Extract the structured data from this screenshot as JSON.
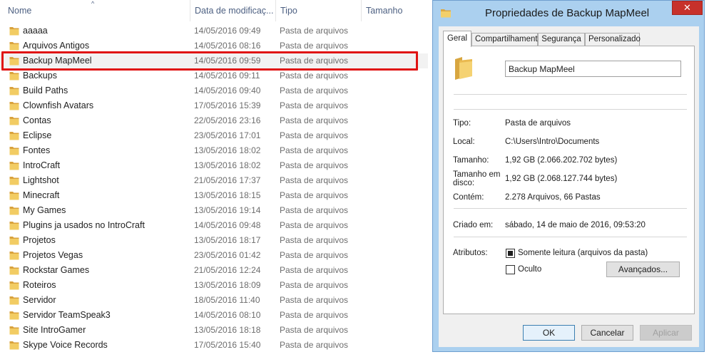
{
  "explorer": {
    "columns": {
      "name": "Nome",
      "date": "Data de modificaç...",
      "type": "Tipo",
      "size": "Tamanho"
    },
    "sort_indicator": "^",
    "rows": [
      {
        "name": "aaaaa",
        "date": "14/05/2016 09:49",
        "type": "Pasta de arquivos"
      },
      {
        "name": "Arquivos Antigos",
        "date": "14/05/2016 08:16",
        "type": "Pasta de arquivos"
      },
      {
        "name": "Backup MapMeel",
        "date": "14/05/2016 09:59",
        "type": "Pasta de arquivos"
      },
      {
        "name": "Backups",
        "date": "14/05/2016 09:11",
        "type": "Pasta de arquivos"
      },
      {
        "name": "Build Paths",
        "date": "14/05/2016 09:40",
        "type": "Pasta de arquivos"
      },
      {
        "name": "Clownfish Avatars",
        "date": "17/05/2016 15:39",
        "type": "Pasta de arquivos"
      },
      {
        "name": "Contas",
        "date": "22/05/2016 23:16",
        "type": "Pasta de arquivos"
      },
      {
        "name": "Eclipse",
        "date": "23/05/2016 17:01",
        "type": "Pasta de arquivos"
      },
      {
        "name": "Fontes",
        "date": "13/05/2016 18:02",
        "type": "Pasta de arquivos"
      },
      {
        "name": "IntroCraft",
        "date": "13/05/2016 18:02",
        "type": "Pasta de arquivos"
      },
      {
        "name": "Lightshot",
        "date": "21/05/2016 17:37",
        "type": "Pasta de arquivos"
      },
      {
        "name": "Minecraft",
        "date": "13/05/2016 18:15",
        "type": "Pasta de arquivos"
      },
      {
        "name": "My Games",
        "date": "13/05/2016 19:14",
        "type": "Pasta de arquivos"
      },
      {
        "name": "Plugins ja usados no IntroCraft",
        "date": "14/05/2016 09:48",
        "type": "Pasta de arquivos"
      },
      {
        "name": "Projetos",
        "date": "13/05/2016 18:17",
        "type": "Pasta de arquivos"
      },
      {
        "name": "Projetos Vegas",
        "date": "23/05/2016 01:42",
        "type": "Pasta de arquivos"
      },
      {
        "name": "Rockstar Games",
        "date": "21/05/2016 12:24",
        "type": "Pasta de arquivos"
      },
      {
        "name": "Roteiros",
        "date": "13/05/2016 18:09",
        "type": "Pasta de arquivos"
      },
      {
        "name": "Servidor",
        "date": "18/05/2016 11:40",
        "type": "Pasta de arquivos"
      },
      {
        "name": "Servidor TeamSpeak3",
        "date": "14/05/2016 08:10",
        "type": "Pasta de arquivos"
      },
      {
        "name": "Site IntroGamer",
        "date": "13/05/2016 18:18",
        "type": "Pasta de arquivos"
      },
      {
        "name": "Skype Voice Records",
        "date": "17/05/2016 15:40",
        "type": "Pasta de arquivos"
      }
    ],
    "selected_row": 2
  },
  "dialog": {
    "title": "Propriedades de Backup MapMeel",
    "close_glyph": "✕",
    "tabs": [
      {
        "label": "Geral",
        "active": true
      },
      {
        "label": "Compartilhamento",
        "active": false
      },
      {
        "label": "Segurança",
        "active": false
      },
      {
        "label": "Personalizado",
        "active": false
      }
    ],
    "folder_name": "Backup MapMeel",
    "properties": {
      "tipo_label": "Tipo:",
      "tipo_value": "Pasta de arquivos",
      "local_label": "Local:",
      "local_value": "C:\\Users\\Intro\\Documents",
      "tamanho_label": "Tamanho:",
      "tamanho_value": "1,92 GB (2.066.202.702 bytes)",
      "tamanho_disco_label_1": "Tamanho em",
      "tamanho_disco_label_2": "disco:",
      "tamanho_disco_value": "1,92 GB (2.068.127.744 bytes)",
      "contem_label": "Contém:",
      "contem_value": "2.278 Arquivos, 66 Pastas",
      "criado_label": "Criado em:",
      "criado_value": "sábado, 14 de maio de 2016, 09:53:20",
      "atributos_label": "Atributos:",
      "somente_leitura_label": "Somente leitura (arquivos da pasta)",
      "oculto_label": "Oculto",
      "avancados_label": "Avançados..."
    },
    "buttons": {
      "ok": "OK",
      "cancel": "Cancelar",
      "apply": "Aplicar"
    }
  },
  "colors": {
    "highlight": "#e01414",
    "folder": "#e8bd4f",
    "dialog_frame": "#abd0ef",
    "close_button": "#c7312b"
  }
}
